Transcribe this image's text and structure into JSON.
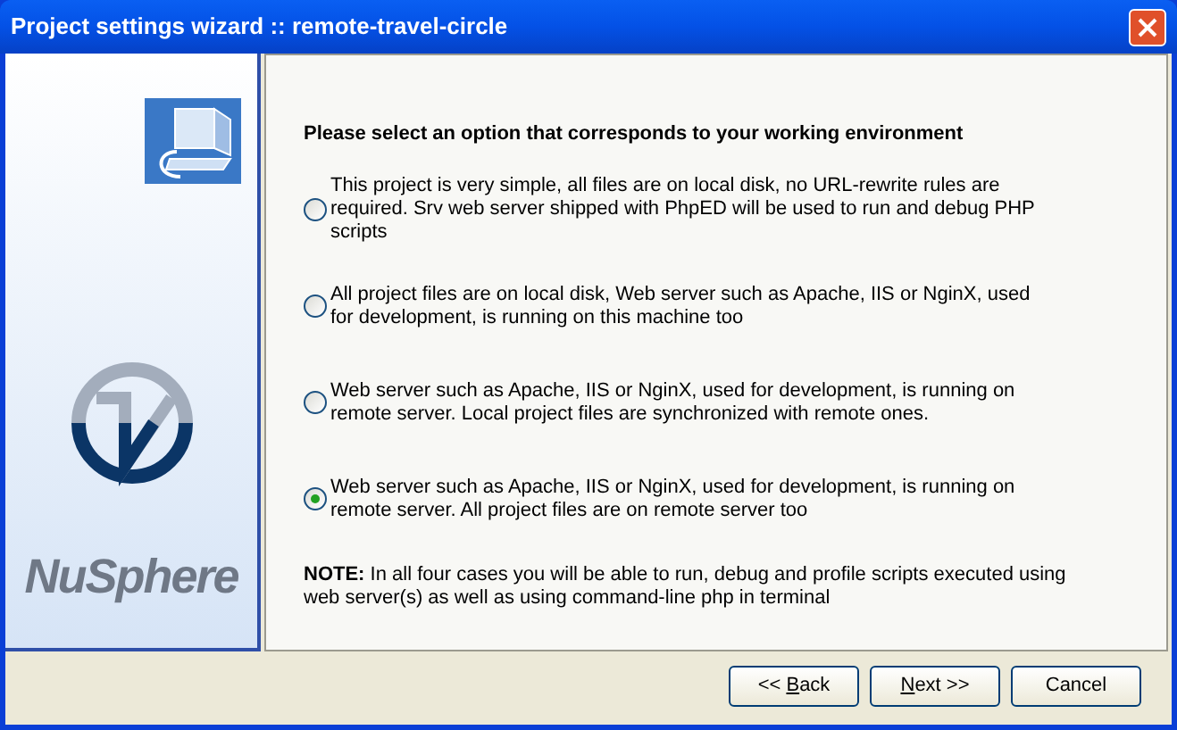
{
  "window": {
    "title": "Project settings wizard :: remote-travel-circle"
  },
  "sidebar": {
    "brand": "NuSphere"
  },
  "heading": "Please select an option that corresponds to your working environment",
  "options": [
    {
      "label": "This project is very simple, all files are on local disk, no URL-rewrite rules are required. Srv web server shipped with PhpED will be used to run and debug PHP scripts",
      "selected": false
    },
    {
      "label": "All project files are on local disk, Web server such as Apache, IIS or NginX, used for development, is running on this machine too",
      "selected": false
    },
    {
      "label": "Web server such as Apache, IIS or NginX, used for development, is running on remote server. Local project files are synchronized with remote ones.",
      "selected": false
    },
    {
      "label": "Web server such as Apache, IIS or NginX, used for development, is running on remote server. All project files are on remote server too",
      "selected": true
    }
  ],
  "note": "**NOTE:** In all four cases you will be able to run, debug and profile scripts executed using web server(s) as well as using command-line php in terminal",
  "buttons": [
    {
      "before": "<< ",
      "access_key": "B",
      "after": "ack"
    },
    {
      "access_key": "N",
      "after": "ext >>"
    },
    {
      "before": "Cancel"
    }
  ]
}
